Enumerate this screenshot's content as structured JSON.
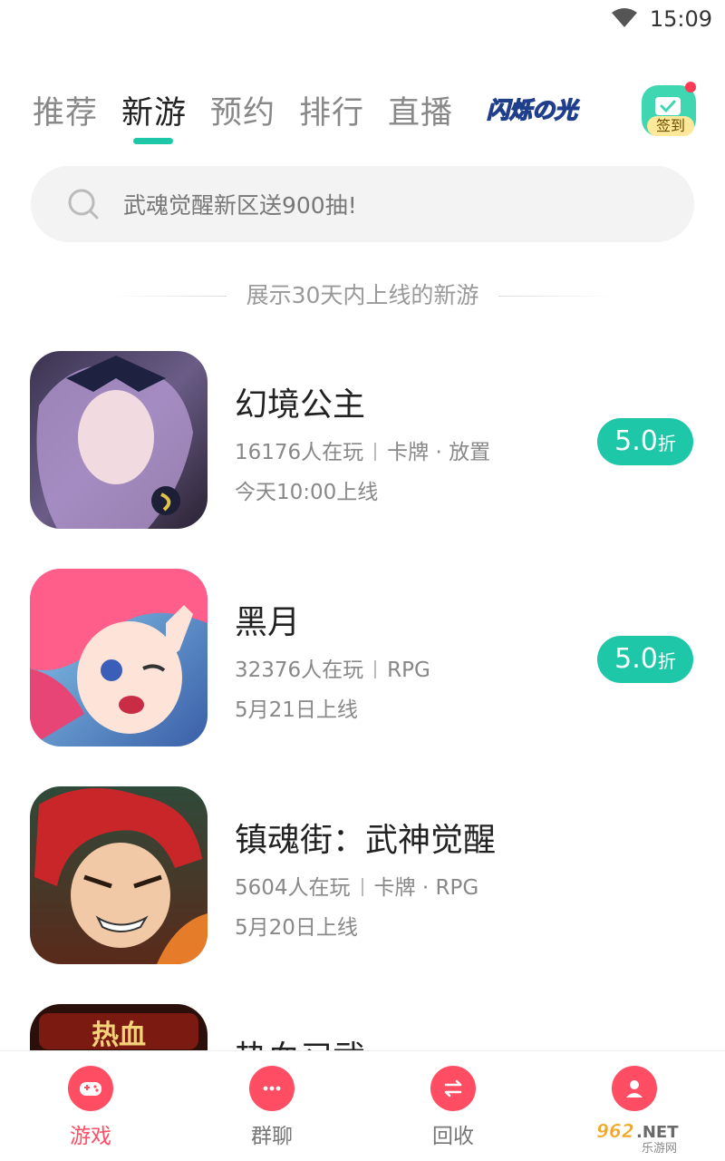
{
  "status_bar": {
    "time": "15:09"
  },
  "tabs": [
    {
      "label": "推荐",
      "active": false
    },
    {
      "label": "新游",
      "active": true
    },
    {
      "label": "预约",
      "active": false
    },
    {
      "label": "排行",
      "active": false
    },
    {
      "label": "直播",
      "active": false
    }
  ],
  "promo_logo": {
    "text": "闪烁の光"
  },
  "signin": {
    "label": "签到"
  },
  "search": {
    "placeholder": "武魂觉醒新区送900抽!"
  },
  "section_note": "展示30天内上线的新游",
  "games": [
    {
      "title": "幻境公主",
      "players": "16176人在玩",
      "tags": "卡牌 · 放置",
      "launch": "今天10:00上线",
      "discount": {
        "value": "5.0",
        "unit": "折"
      }
    },
    {
      "title": "黑月",
      "players": "32376人在玩",
      "tags": "RPG",
      "launch": "5月21日上线",
      "discount": {
        "value": "5.0",
        "unit": "折"
      }
    },
    {
      "title": "镇魂街：武神觉醒",
      "players": "5604人在玩",
      "tags": "卡牌 · RPG",
      "launch": "5月20日上线",
      "discount": null
    },
    {
      "title": "热血习武",
      "players": "",
      "tags": "",
      "launch": "",
      "discount": null
    }
  ],
  "bottom_nav": [
    {
      "label": "游戏",
      "icon": "gamepad-icon",
      "active": true
    },
    {
      "label": "群聊",
      "icon": "chat-icon",
      "active": false
    },
    {
      "label": "回收",
      "icon": "recycle-icon",
      "active": false
    },
    {
      "label": "",
      "icon": "profile-icon",
      "active": false
    }
  ],
  "watermark": {
    "text": "962.NET 乐游网"
  },
  "colors": {
    "accent": "#1ec7a8",
    "nav_active": "#ff4d63",
    "tab_inactive": "#888888"
  }
}
